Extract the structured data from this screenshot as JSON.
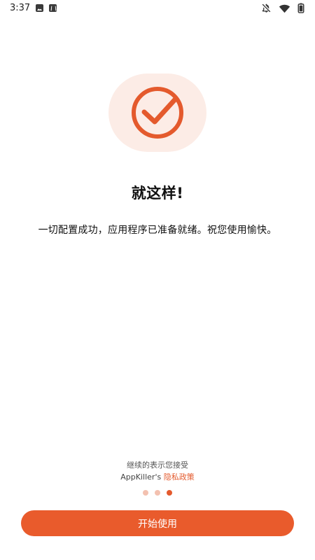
{
  "status_bar": {
    "time": "3:37",
    "left_icons": [
      "photo-icon",
      "alpha-icon"
    ],
    "right_icons": [
      "notifications-off-icon",
      "wifi-icon",
      "battery-icon"
    ]
  },
  "hero": {
    "icon": "check-circle-icon",
    "accent_color": "#e45a2d",
    "bg_color": "#fcece6"
  },
  "content": {
    "title": "就这样!",
    "message": "一切配置成功，应用程序已准备就绪。祝您使用愉快。"
  },
  "consent": {
    "line1": "继续的表示您接受",
    "app_name": "AppKiller's",
    "policy_link": "隐私政策"
  },
  "pagination": {
    "total": 3,
    "active_index": 2
  },
  "actions": {
    "start_label": "开始使用"
  }
}
